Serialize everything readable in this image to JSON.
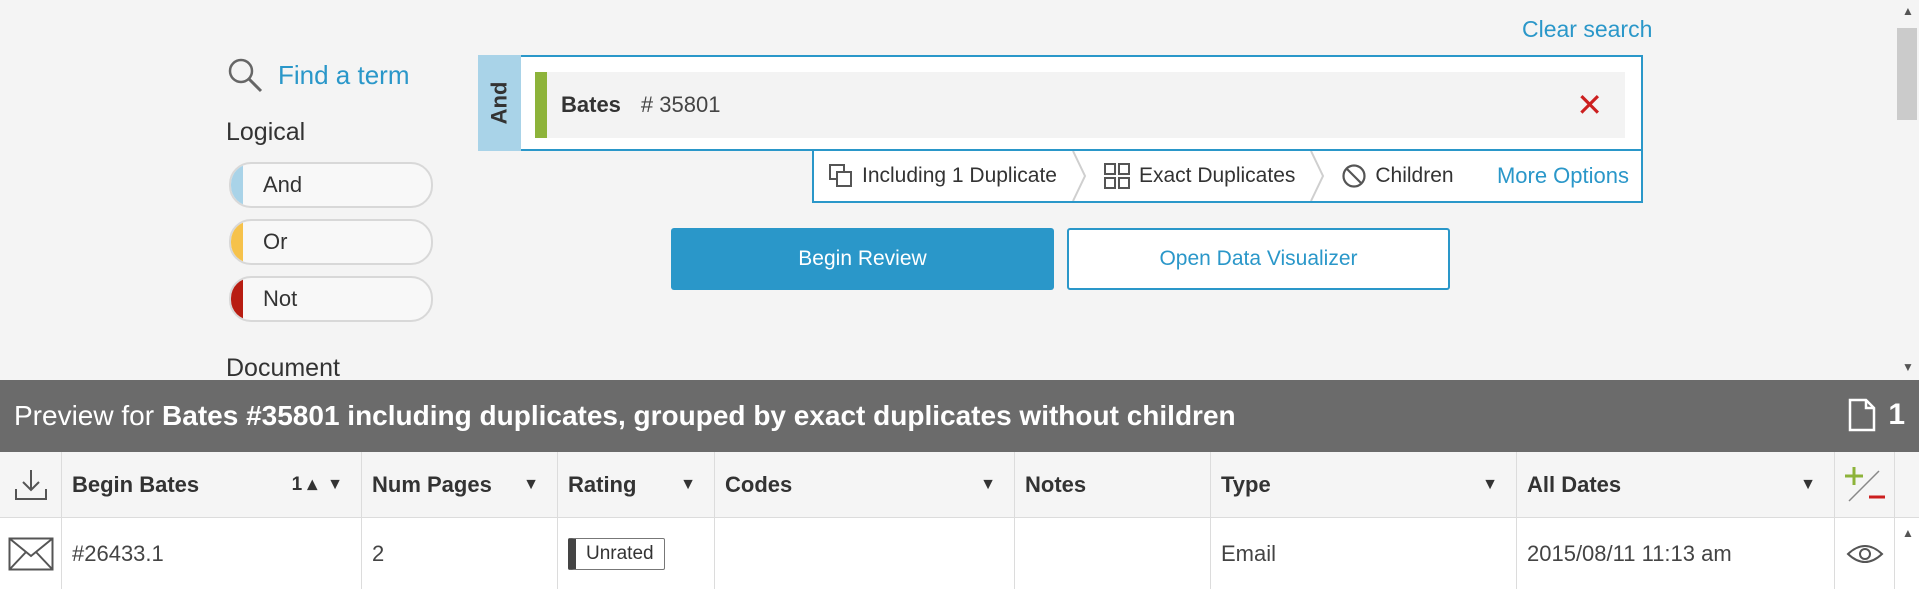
{
  "search": {
    "clear_label": "Clear search",
    "find_term_label": "Find a term",
    "logical_heading": "Logical",
    "logical_options": [
      {
        "label": "And",
        "color": "#a9d3e8"
      },
      {
        "label": "Or",
        "color": "#f6c24b"
      },
      {
        "label": "Not",
        "color": "#b81d12"
      }
    ],
    "document_heading": "Document",
    "group_operator": "And",
    "term": {
      "field": "Bates",
      "value": "# 35801"
    },
    "options": {
      "duplicates": "Including 1 Duplicate",
      "grouping": "Exact Duplicates",
      "children": "Children",
      "more": "More Options"
    },
    "begin_review_label": "Begin Review",
    "open_visualizer_label": "Open Data Visualizer"
  },
  "preview": {
    "prefix": "Preview for",
    "description": "Bates #35801 including duplicates, grouped by exact duplicates without children",
    "count": "1"
  },
  "table": {
    "columns": [
      {
        "label": "Begin Bates",
        "sort": "1 ▴"
      },
      {
        "label": "Num Pages"
      },
      {
        "label": "Rating"
      },
      {
        "label": "Codes"
      },
      {
        "label": "Notes"
      },
      {
        "label": "Type"
      },
      {
        "label": "All Dates"
      }
    ],
    "rows": [
      {
        "icon": "envelope-icon",
        "begin_bates": "#26433.1",
        "num_pages": "2",
        "rating": "Unrated",
        "codes": "",
        "notes": "",
        "type": "Email",
        "all_dates": "2015/08/11 11:13 am"
      }
    ]
  },
  "colors": {
    "accent": "#2a97c9",
    "term_bar": "#8db33a",
    "preview_bar": "#6b6b6b",
    "remove": "#cc1f1f"
  }
}
